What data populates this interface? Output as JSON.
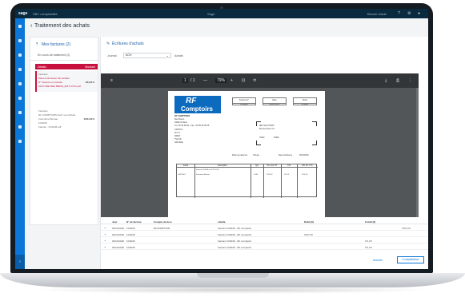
{
  "topbar": {
    "logo": "sage",
    "company": "SBC comptabilité",
    "center_title": "Sage",
    "right_text": "Besoin d'aide",
    "help_icon": "question-icon",
    "settings_icon": "gear-icon",
    "user_icon": "user-icon"
  },
  "page": {
    "title": "Traitement des achats"
  },
  "left_panel": {
    "heading": "Mes factures (2)",
    "subheading": "En cours de traitement (2)",
    "list_header": {
      "left": "Détails",
      "right": "Montant"
    },
    "items": [
      {
        "lines": [
          "Factures",
          "Pièce fournisseur des Achats",
          "N° Facture en recettes",
          "FACTURE DES BIENS_2017-07-01.pdf"
        ],
        "amount": "XX,XX €"
      },
      {
        "lines": [
          "Factures",
          "RF COMPTOIRS Sud / Les Achats",
          "Fourniture Bureau",
          "FC0046",
          "Facture : FC0046.pdf"
        ],
        "amount": "XXX,XX €"
      }
    ]
  },
  "right_panel": {
    "heading": "Écritures d'achats",
    "journal_label": "Journal",
    "journal_value": "ACH",
    "journal_desc": "Achats"
  },
  "pdf_toolbar": {
    "menu": "≡",
    "page_current": "1",
    "page_total": "/ 1",
    "minus": "—",
    "zoom": "79%",
    "plus": "+",
    "fit": "⊡",
    "rotate": "⟲",
    "download": "⤓",
    "print": "⎙",
    "more": "⋮"
  },
  "invoice": {
    "logo_top": "RF",
    "logo_bottom": "Comptoirs",
    "address_lines": [
      "RF COMPTOIRS",
      "Rue Bosco",
      "34000 Poitiers",
      "Tél. 05 05 05 05 - Fax : 05 05 05 05 05",
      "CAPITAL",
      "R.C.S.",
      "SIRET",
      "TVA FR",
      "NAF/APE"
    ],
    "hdr_boxes": [
      {
        "k": "Facture N°",
        "v": "FC0046"
      },
      {
        "k": "Date",
        "v": "2017-07-01"
      },
      {
        "k": "Client",
        "v": "CL0001"
      }
    ],
    "bill_to": [
      "SBC SOLUTIONS",
      "Rue des Fleurs 12",
      "75000",
      "PARIS"
    ],
    "payment": [
      "Mode de paiement",
      "Chèque",
      "Date d'échéance",
      "30/01/2018"
    ],
    "table_headers": [
      "Article",
      "Description",
      "Qté",
      "Prix Unit. HT",
      "TVA",
      "Prix Tot. TTC"
    ],
    "rows": [
      {
        "article": "",
        "desc": "Facture FC0046 du 2017-07-01",
        "qty": "",
        "pu": "",
        "tva": "",
        "tot": ""
      },
      {
        "article": "ART0001",
        "desc": "Fourniture Bureau",
        "qty": "1,000",
        "pu": "XXX,XX",
        "tva": "XX,XX",
        "tot": "XXX,XX"
      }
    ]
  },
  "bottom_table": {
    "headers": [
      "Jour",
      "N° de facture",
      "Compte de tiers",
      "Libellé",
      "Débit (€)",
      "Crédit (€)"
    ],
    "rows": [
      {
        "jour": "02/11/2018",
        "no": "FC0046",
        "tiers": "RFCOMPTOIR",
        "libelle": "Facture FC0046 - RF comptoirs",
        "debit": "",
        "credit": "XXX,XX"
      },
      {
        "jour": "02/11/2018",
        "no": "FC0046",
        "tiers": "",
        "libelle": "Facture FC0046 - RF comptoirs",
        "debit": "XXX,XX",
        "credit": ""
      },
      {
        "jour": "02/11/2018",
        "no": "FC0046",
        "tiers": "",
        "libelle": "Facture FC0046 - RF comptoirs",
        "debit": "XX,XX",
        "credit": ""
      },
      {
        "jour": "02/11/2018",
        "no": "FC0046",
        "tiers": "",
        "libelle": "Facture FC0046 - RF comptoirs",
        "debit": "XX,XX",
        "credit": ""
      }
    ],
    "cancel": "Annuler",
    "validate": "Comptabiliser"
  },
  "colors": {
    "accent": "#0b77d8",
    "brand_red": "#c8103e",
    "topbar": "#0a2a3f",
    "pdf_bg": "#525659"
  }
}
